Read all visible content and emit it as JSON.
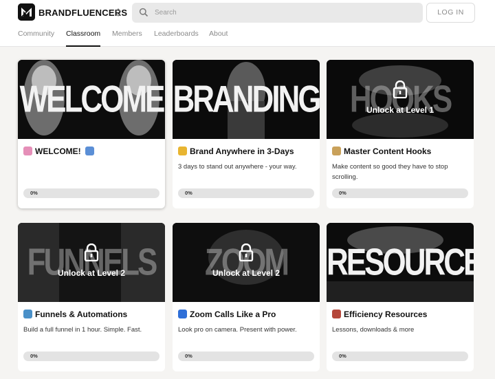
{
  "header": {
    "brand": "BRANDFLUENCERS",
    "logo_icon": "logo-icon",
    "search_placeholder": "Search",
    "login_label": "LOG IN"
  },
  "tabs": [
    {
      "label": "Community",
      "active": false
    },
    {
      "label": "Classroom",
      "active": true
    },
    {
      "label": "Members",
      "active": false
    },
    {
      "label": "Leaderboards",
      "active": false
    },
    {
      "label": "About",
      "active": false
    }
  ],
  "courses": [
    {
      "cover_text": "WELCOME",
      "emoji_icon": "brain-emoji-icon",
      "emoji_color": "#e58fb8",
      "emoji2_icon": "down-arrow-emoji-icon",
      "emoji2_color": "#5b8fd6",
      "title": "WELCOME!",
      "description": "",
      "progress": "0%",
      "progress_value": 0,
      "locked": false
    },
    {
      "cover_text": "BRANDING",
      "emoji_icon": "pill-emoji-icon",
      "emoji_color": "#e8b531",
      "title": "Brand Anywhere in 3-Days",
      "description": "3 days to stand out anywhere - your way.",
      "progress": "0%",
      "progress_value": 0,
      "locked": false
    },
    {
      "cover_text": "HOOKS",
      "emoji_icon": "hook-emoji-icon",
      "emoji_color": "#c9a15a",
      "title": "Master Content Hooks",
      "description": "Make content so good they have to stop scrolling.",
      "progress": "0%",
      "progress_value": 0,
      "locked": true,
      "lock_text": "Unlock at Level 1"
    },
    {
      "cover_text": "FUNNELS",
      "emoji_icon": "whale-emoji-icon",
      "emoji_color": "#4a90c8",
      "title": "Funnels & Automations",
      "description": "Build a full funnel in 1 hour. Simple. Fast.",
      "progress": "0%",
      "progress_value": 0,
      "locked": true,
      "lock_text": "Unlock at Level 2"
    },
    {
      "cover_text": "ZOOM",
      "emoji_icon": "blue-heart-emoji-icon",
      "emoji_color": "#2f6fd8",
      "title": "Zoom Calls Like a Pro",
      "description": "Look pro on camera. Present with power.",
      "progress": "0%",
      "progress_value": 0,
      "locked": true,
      "lock_text": "Unlock at Level 2"
    },
    {
      "cover_text": "RESOURCE",
      "emoji_icon": "books-emoji-icon",
      "emoji_color": "#b5473a",
      "title": "Efficiency Resources",
      "description": "Lessons, downloads & more",
      "progress": "0%",
      "progress_value": 0,
      "locked": false
    }
  ]
}
